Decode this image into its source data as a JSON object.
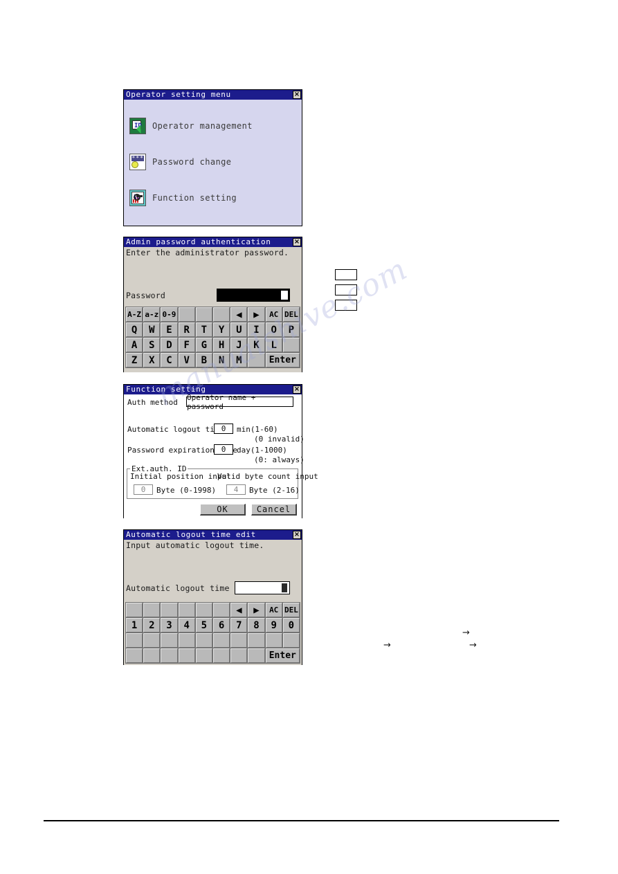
{
  "watermark": "manualshive.com",
  "dialogs": {
    "operator_menu": {
      "title": "Operator setting menu",
      "close_label": "×",
      "items": [
        {
          "icon": "operator-management-icon",
          "label": "Operator management"
        },
        {
          "icon": "password-change-icon",
          "label": "Password change"
        },
        {
          "icon": "function-setting-icon",
          "label": "Function setting"
        }
      ]
    },
    "admin_auth": {
      "title": "Admin password authentication",
      "close_label": "×",
      "prompt": "Enter the administrator password.",
      "password_label": "Password",
      "password_value": "",
      "keyboard": {
        "rows": [
          [
            "A-Z",
            "a-z",
            "0-9",
            "",
            "",
            "",
            "◀",
            "▶",
            "AC",
            "DEL"
          ],
          [
            "Q",
            "W",
            "E",
            "R",
            "T",
            "Y",
            "U",
            "I",
            "O",
            "P"
          ],
          [
            "A",
            "S",
            "D",
            "F",
            "G",
            "H",
            "J",
            "K",
            "L",
            ""
          ],
          [
            "Z",
            "X",
            "C",
            "V",
            "B",
            "N",
            "M",
            "",
            "Enter",
            ""
          ]
        ]
      }
    },
    "function_setting": {
      "title": "Function setting",
      "close_label": "×",
      "auth_method_label": "Auth method",
      "auth_method_value": "Operator name + password",
      "auto_logout_label": "Automatic logout time",
      "auto_logout_value": "0",
      "auto_logout_unit": "min(1-60)",
      "auto_logout_note": "(0 invalid)",
      "password_expire_label": "Password expiration date",
      "password_expire_value": "0",
      "password_expire_unit": "day(1-1000)",
      "password_expire_note": "(0: always)",
      "ext_auth_group_title": "Ext.auth. ID",
      "initial_position_label": "Initial position input",
      "initial_position_value": "0",
      "initial_position_unit": "Byte (0-1998)",
      "valid_byte_label": "Valid byte count input",
      "valid_byte_value": "4",
      "valid_byte_unit": "Byte (2-16)",
      "ok_label": "OK",
      "cancel_label": "Cancel"
    },
    "logout_edit": {
      "title": "Automatic logout time edit",
      "close_label": "×",
      "prompt": "Input automatic logout time.",
      "field_label": "Automatic logout time",
      "field_value": "",
      "keyboard": {
        "rows": [
          [
            "",
            "",
            "",
            "",
            "",
            "",
            "◀",
            "▶",
            "AC",
            "DEL"
          ],
          [
            "1",
            "2",
            "3",
            "4",
            "5",
            "6",
            "7",
            "8",
            "9",
            "0"
          ],
          [
            "",
            "",
            "",
            "",
            "",
            "",
            "",
            "",
            "",
            ""
          ],
          [
            "",
            "",
            "",
            "",
            "",
            "",
            "",
            "",
            "Enter",
            ""
          ]
        ]
      }
    }
  },
  "callout_boxes": [
    {
      "label": ""
    },
    {
      "label": ""
    },
    {
      "label": ""
    }
  ],
  "arrows": [
    {
      "glyph": "→"
    },
    {
      "glyph": "→"
    },
    {
      "glyph": "→"
    }
  ],
  "colors": {
    "titlebar": "#1c1c8c",
    "menu_body": "#d6d6ee",
    "got_body": "#d4d0c8",
    "key_face": "#b9b9b9"
  }
}
